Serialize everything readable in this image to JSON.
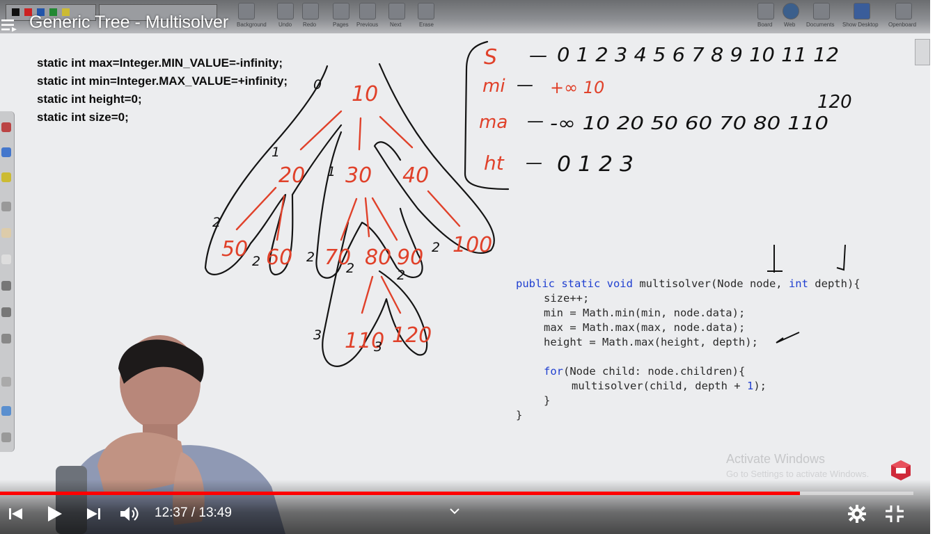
{
  "video": {
    "title": "Generic Tree - Multisolver",
    "current_time": "12:37",
    "duration": "13:49",
    "time_display": "12:37 / 13:49",
    "progress_fraction": 0.876
  },
  "toolbar": {
    "labels": [
      "Background",
      "Undo",
      "Redo",
      "Pages",
      "Previous",
      "Next",
      "Erase",
      "Board",
      "Web",
      "Documents",
      "Show Desktop",
      "Openboard"
    ]
  },
  "declarations": [
    "static int max=Integer.MIN_VALUE=-infinity;",
    "static int min=Integer.MAX_VALUE=+infinity;",
    "static int height=0;",
    "static int size=0;"
  ],
  "code": {
    "signature_pre": "public static void multisolver(Node node, ",
    "sig_kw1": "public static void",
    "sig_name": " multisolver(Node node, ",
    "sig_kw2": "int",
    "sig_tail": " depth){",
    "line_size": "size++;",
    "line_min": "min = Math.min(min, node.data);",
    "line_max": "max = Math.max(max, node.data);",
    "line_height": "height = Math.max(height, depth);",
    "line_for_kw": "for",
    "line_for_rest": "(Node child: node.children){",
    "line_call_pre": "multisolver(child, depth + ",
    "line_call_num": "1",
    "line_call_post": ");",
    "close_inner": "}",
    "close_outer": "}"
  },
  "tree": {
    "nodes": [
      "10",
      "20",
      "30",
      "40",
      "50",
      "60",
      "70",
      "80",
      "90",
      "100",
      "110",
      "120"
    ],
    "depths": [
      "0",
      "1",
      "1",
      "2",
      "2",
      "2",
      "2",
      "2",
      "2",
      "3",
      "3"
    ]
  },
  "notes": {
    "s_label": "S",
    "s_values": "0 1 2 3 4 5 6 7 8 9 10 11 12",
    "s_final": "12",
    "mi_label": "mi",
    "mi_values": "+∞ 10",
    "mi_final": "10",
    "ma_label": "ma",
    "ma_values": "-∞ 10 20 50 60 70 80 110",
    "ma_final": "120",
    "ht_label": "ht",
    "ht_values": "0 1 2 3",
    "ht_final": "3"
  },
  "watermark": {
    "title": "Activate Windows",
    "subtitle": "Go to Settings to activate Windows."
  },
  "colors": {
    "progress": "#ff0000",
    "ink_red": "#e0412a",
    "ink_black": "#111111",
    "code_keyword": "#1f3fd0"
  }
}
